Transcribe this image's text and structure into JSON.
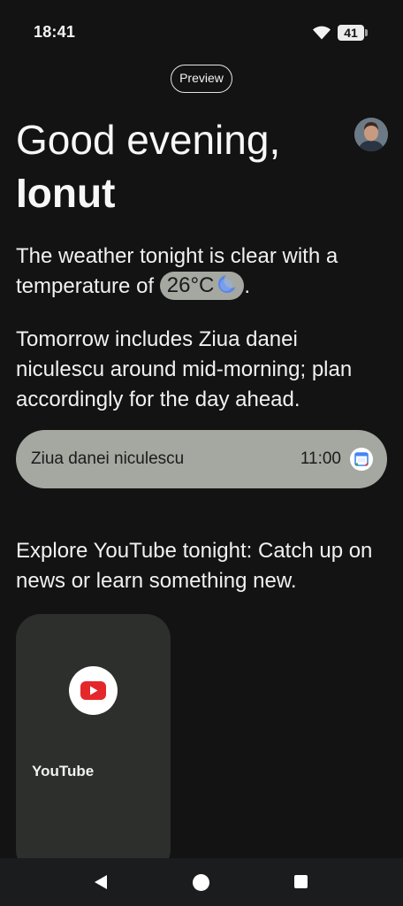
{
  "status_bar": {
    "time": "18:41",
    "battery_level": "41",
    "icons": [
      "wifi-icon",
      "battery-icon"
    ]
  },
  "preview_label": "Preview",
  "greeting": {
    "line1": "Good evening,",
    "name": "Ionut"
  },
  "weather": {
    "text_before": "The weather tonight is clear with a temperature of",
    "temperature": "26°C",
    "text_after": ".",
    "icon": "moon-icon"
  },
  "calendar_summary": "Tomorrow includes Ziua danei niculescu around mid-morning; plan accordingly for the day ahead.",
  "event": {
    "title": "Ziua danei niculescu",
    "time": "11:00",
    "icon": "google-calendar-icon"
  },
  "explore_text": "Explore YouTube tonight: Catch up on news or learn something new.",
  "app_card": {
    "label": "YouTube",
    "icon": "youtube-icon"
  },
  "nav_bar": {
    "icons": [
      "back-icon",
      "home-icon",
      "recents-icon"
    ]
  },
  "colors": {
    "background": "#131313",
    "chip": "#a5a7a1",
    "card": "#2c2f2b",
    "youtube_red": "#e4272a"
  }
}
